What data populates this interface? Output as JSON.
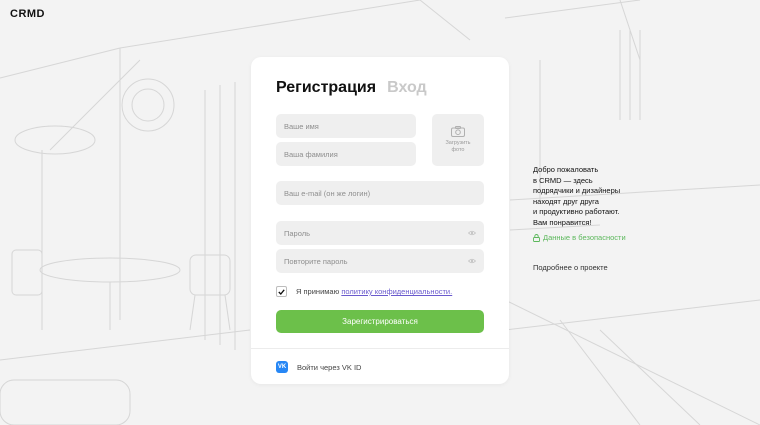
{
  "brand": {
    "logo": "CRMD"
  },
  "form": {
    "tabs": [
      {
        "label": "Регистрация",
        "active": true
      },
      {
        "label": "Вход",
        "active": false
      }
    ],
    "first_name": {
      "placeholder": "Ваше имя",
      "value": ""
    },
    "last_name": {
      "placeholder": "Ваша фамилия",
      "value": ""
    },
    "photo": {
      "label_line1": "Загрузить",
      "label_line2": "фото"
    },
    "email": {
      "placeholder": "Ваш e-mail (он же логин)",
      "value": ""
    },
    "password": {
      "placeholder": "Пароль",
      "value": ""
    },
    "password_repeat": {
      "placeholder": "Повторите пароль",
      "value": ""
    },
    "agree": {
      "checked": true,
      "text": "Я принимаю",
      "link": "политику конфиденциальности."
    },
    "submit_label": "Зарегистрироваться",
    "vk": {
      "logo": "VK",
      "label": "Войти через VK ID"
    }
  },
  "aside": {
    "welcome_lines": [
      "Добро пожаловать",
      "в CRMD — здесь",
      "подрядчики и дизайнеры",
      "находят друг друга",
      "и продуктивно работают.",
      "Вам понравится!"
    ],
    "security_link": "Данные в безопасности",
    "more_link": "Подробнее о проекте"
  },
  "colors": {
    "accent_green": "#6cc04a",
    "link_purple": "#6a5acd",
    "vk_blue": "#2787f5",
    "background": "#f3f3f3"
  }
}
